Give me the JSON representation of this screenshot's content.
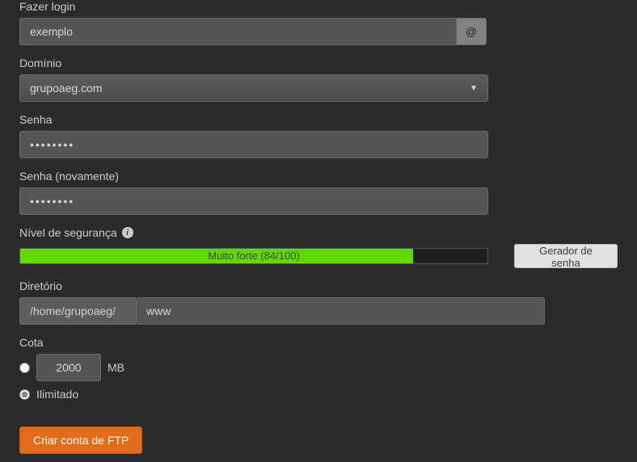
{
  "login": {
    "label": "Fazer login",
    "value": "exemplo",
    "addon": "@"
  },
  "domain": {
    "label": "Domínio",
    "selected": "grupoaeg.com"
  },
  "password": {
    "label": "Senha",
    "value": "••••••••"
  },
  "password2": {
    "label": "Senha (novamente)",
    "value": "••••••••"
  },
  "strength": {
    "label": "Nível de segurança",
    "text": "Muito forte (84/100)",
    "percent": 84,
    "generator_button": "Gerador de senha"
  },
  "directory": {
    "label": "Diretório",
    "prefix": "/home/grupoaeg/",
    "value": "www"
  },
  "quota": {
    "label": "Cota",
    "value": "2000",
    "unit": "MB",
    "unlimited": "Ilimitado"
  },
  "submit": "Criar conta de FTP"
}
